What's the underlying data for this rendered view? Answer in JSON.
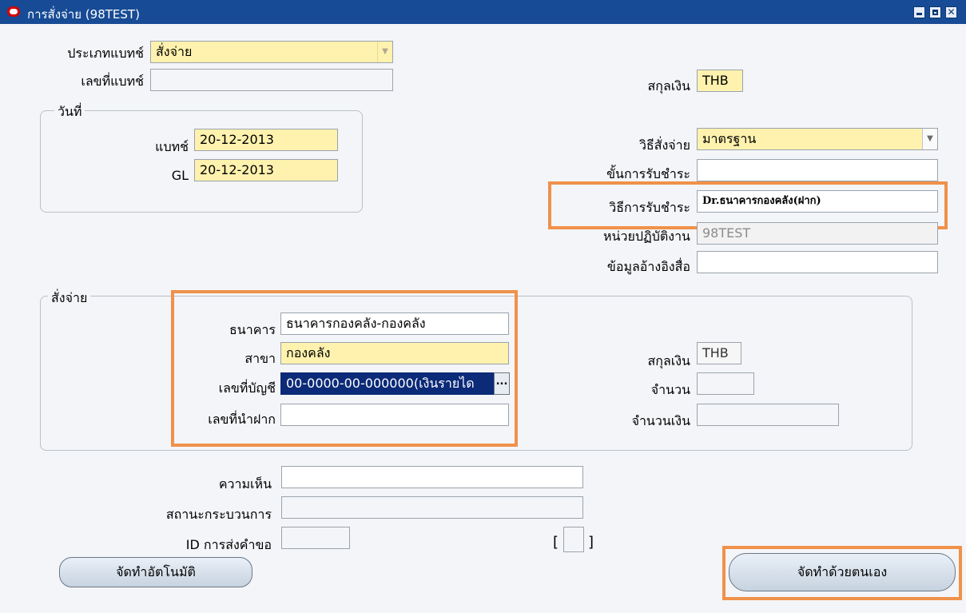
{
  "window": {
    "title": "การสั่งจ่าย (98TEST)",
    "app_icon": "oracle-icon",
    "controls": [
      "minimize-icon",
      "maximize-icon",
      "close-icon"
    ]
  },
  "header": {
    "doc_type_label": "ประเภทแบทช์",
    "doc_type_value": "สั่งจ่าย",
    "doc_no_label": "เลขที่แบทช์",
    "doc_no_value": "",
    "currency_label": "สกุลเงิน",
    "currency_value": "THB"
  },
  "date_group": {
    "title": "วันที่",
    "batch_label": "แบทช์",
    "batch_value": "20-12-2013",
    "gl_label": "GL",
    "gl_value": "20-12-2013"
  },
  "payment": {
    "method_label": "วิธีสั่งจ่าย",
    "method_value": "มาตรฐาน",
    "step_label": "ขั้นการรับชำระ",
    "step_value": "",
    "receipt_method_label": "วิธีการรับชำระ",
    "receipt_method_value": "Dr.ธนาคารกองคลัง(ฝาก)",
    "unit_label": "หน่วยปฏิบัติงาน",
    "unit_value": "98TEST",
    "reference_label": "ข้อมูลอ้างอิงสื่อ",
    "reference_value": ""
  },
  "pay_group": {
    "title": "สั่งจ่าย",
    "bank_label": "ธนาคาร",
    "bank_value": "ธนาคารกองคลัง-กองคลัง",
    "branch_label": "สาขา",
    "branch_value": "กองคลัง",
    "account_label": "เลขที่บัญชี",
    "account_value": "00-0000-00-000000(เงินรายได",
    "deposit_label": "เลขที่นำฝาก",
    "deposit_value": "",
    "currency_label": "สกุลเงิน",
    "currency_value": "THB",
    "count_label": "จำนวน",
    "count_value": "",
    "amount_label": "จำนวนเงิน",
    "amount_value": "",
    "lov_button": "..."
  },
  "footer": {
    "comment_label": "ความเห็น",
    "comment_value": "",
    "status_label": "สถานะกระบวนการ",
    "status_value": "",
    "request_id_label": "ID การส่งคำขอ",
    "request_id_value": "",
    "bracket_open": "[",
    "bracket_close": "]",
    "auto_button": "จัดทำอัตโนมัติ",
    "manual_button": "จัดทำด้วยตนเอง"
  },
  "colors": {
    "titlebar": "#174b95",
    "required_field": "#fff2ae",
    "highlight": "#f0914a",
    "selection": "#0b2a78"
  }
}
